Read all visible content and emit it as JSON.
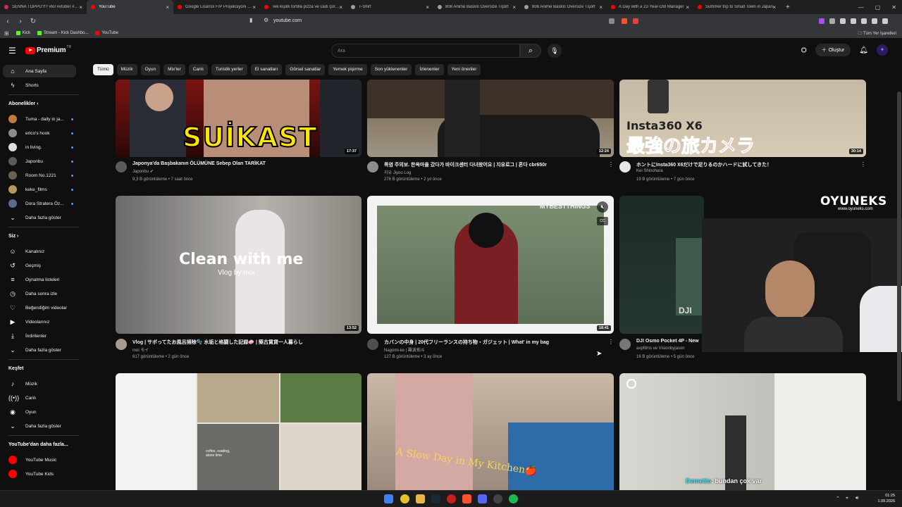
{
  "browser": {
    "tabs": [
      {
        "label": "SENNA TOPPU?!? #lol #vtuber #rag",
        "color": "#e91e63"
      },
      {
        "label": "YouTube",
        "color": "#ff0000",
        "active": true
      },
      {
        "label": "Google Lisanslı F/P Projeksiyoni Fun",
        "color": "#ff0000"
      },
      {
        "label": "Tek kişilik tortilla pizza ve cadı çorba",
        "color": "#ff0000"
      },
      {
        "label": "T-Shirt",
        "color": "#9aa0a6"
      },
      {
        "label": "808 Anime Baskılı Oversize Tişört",
        "color": "#9aa0a6"
      },
      {
        "label": "808 Anime Baskılı Oversize Tişört",
        "color": "#9aa0a6"
      },
      {
        "label": "A Day with a 22-Year-Old Manager",
        "color": "#ff0000"
      },
      {
        "label": "Summer trip to Small Town in Japan",
        "color": "#ff0000"
      }
    ],
    "new_tab": "+",
    "url": "youtube.com",
    "bookmarks": [
      {
        "label": "Kick",
        "color": "#53fc18"
      },
      {
        "label": "Stream - Kick Dashbo...",
        "color": "#53fc18"
      },
      {
        "label": "YouTube",
        "color": "#ff0000"
      }
    ],
    "all_bookmarks": "Tüm Yer İşaretleri"
  },
  "header": {
    "logo_text": "Premium",
    "logo_sup": "TR",
    "search_placeholder": "Ara",
    "create_label": "Oluştur",
    "avatar_letter": "✦"
  },
  "sidebar": {
    "main": [
      {
        "label": "Ana Sayfa",
        "icon": "⌂",
        "active": true
      },
      {
        "label": "Shorts",
        "icon": "ϟ"
      }
    ],
    "subscriptions_title": "Abonelikler  ›",
    "subscriptions": [
      {
        "label": "Tuma - daily in ja...",
        "color": "#c47a3a"
      },
      {
        "label": "erico's hook",
        "color": "#8c8c8c"
      },
      {
        "label": "in living.",
        "color": "#e0e0e0"
      },
      {
        "label": "Japonbu",
        "color": "#5a5a5a"
      },
      {
        "label": "Room No.1221",
        "color": "#6b6150"
      },
      {
        "label": "keke_films",
        "color": "#b39a5c"
      },
      {
        "label": "Dora Stratera Öz...",
        "color": "#5c6b8a"
      }
    ],
    "subs_more": "Daha fazla göster",
    "you_title": "Siz  ›",
    "you": [
      {
        "label": "Kanalınız",
        "icon": "☺"
      },
      {
        "label": "Geçmiş",
        "icon": "↺"
      },
      {
        "label": "Oynatma listeleri",
        "icon": "≡"
      },
      {
        "label": "Daha sonra izle",
        "icon": "◷"
      },
      {
        "label": "Beğendiğim videolar",
        "icon": "♡"
      },
      {
        "label": "Videolarınız",
        "icon": "▶"
      },
      {
        "label": "İndirilenler",
        "icon": "⤓"
      },
      {
        "label": "Daha fazla göster",
        "icon": "⌄"
      }
    ],
    "explore_title": "Keşfet",
    "explore": [
      {
        "label": "Müzik",
        "icon": "♪"
      },
      {
        "label": "Canlı",
        "icon": "((•))"
      },
      {
        "label": "Oyun",
        "icon": "◉"
      },
      {
        "label": "Daha fazla göster",
        "icon": "⌄"
      }
    ],
    "more_title": "YouTube'dan daha fazla...",
    "more": [
      {
        "label": "YouTube Music",
        "color": "#ff0000"
      },
      {
        "label": "YouTube Kids",
        "color": "#ff0000"
      }
    ]
  },
  "chips": [
    "Tümü",
    "Müzik",
    "Oyun",
    "Mix'ler",
    "Canlı",
    "Turistik yerler",
    "El sanatları",
    "Görsel sanatlar",
    "Yemek pişirme",
    "Son yüklenenler",
    "İzlenenler",
    "Yeni öneriler"
  ],
  "videos": [
    {
      "title": "Japonya'da Başbakanın ÖLÜMÜNE Sebep Olan TARİKAT",
      "channel": "Japonbu ✔",
      "meta": "9,3 B görüntüleme • 7 saat önce",
      "duration": "17:37",
      "overlay": "SUİKAST"
    },
    {
      "title": "폭염 주의보. 한옥마을 갔다가 바이크센터 다녀왔어요 | 지유로그 | 혼다 cbr650r",
      "channel": "지유 Jiyoo Log",
      "meta": "276 B görüntüleme • 2 yıl önce",
      "duration": "12:24"
    },
    {
      "title": "ホントにInsta360 X6だけで足りるのかハードに試してきた！",
      "channel": "Kei Shinohara",
      "meta": "19 B görüntüleme • 7 gün önce",
      "duration": "30:14",
      "overlay": "Insta360 X6",
      "overlay2": "最強の旅カメラ"
    },
    {
      "title": "Vlog | サボってたお風呂掃除🫧 水垢と格闘した記録🧼 | 築古賃貸一人暮らし",
      "channel": "moi モイ",
      "meta": "617 görüntüleme • 2 gün önce",
      "duration": "13:52",
      "overlay": "Clean with me",
      "overlay2": "Vlog by moi"
    },
    {
      "title": "カバンの中身 | 20代フリーランスの持ち物・ガジェット | What' in my bag",
      "channel": "Nagomi-ke | 難波拓斗",
      "meta": "127 B görüntüleme • 3 ay önce",
      "duration": "18:41",
      "overlay": "MYBESTTHINGS"
    },
    {
      "title": "DJI Osmo Pocket 4P - New",
      "channel": "avpfilms ve Visionbyjason",
      "meta": "16 B görüntüleme • 5 gün önce",
      "overlay": "DJI"
    },
    {
      "title": "",
      "overlay": "coffee, reading, alone time"
    },
    {
      "title": "",
      "overlay": "A Slow Day in My Kitchen🍎"
    },
    {
      "title": ""
    }
  ],
  "stream": {
    "brand": "OYUNEKS",
    "brand_url": "www.oyuneks.com",
    "chat_name": "Demetto",
    "chat_text": ": bundan çok var"
  },
  "taskbar": {
    "time": "01:25",
    "date": "1.09.2026"
  }
}
